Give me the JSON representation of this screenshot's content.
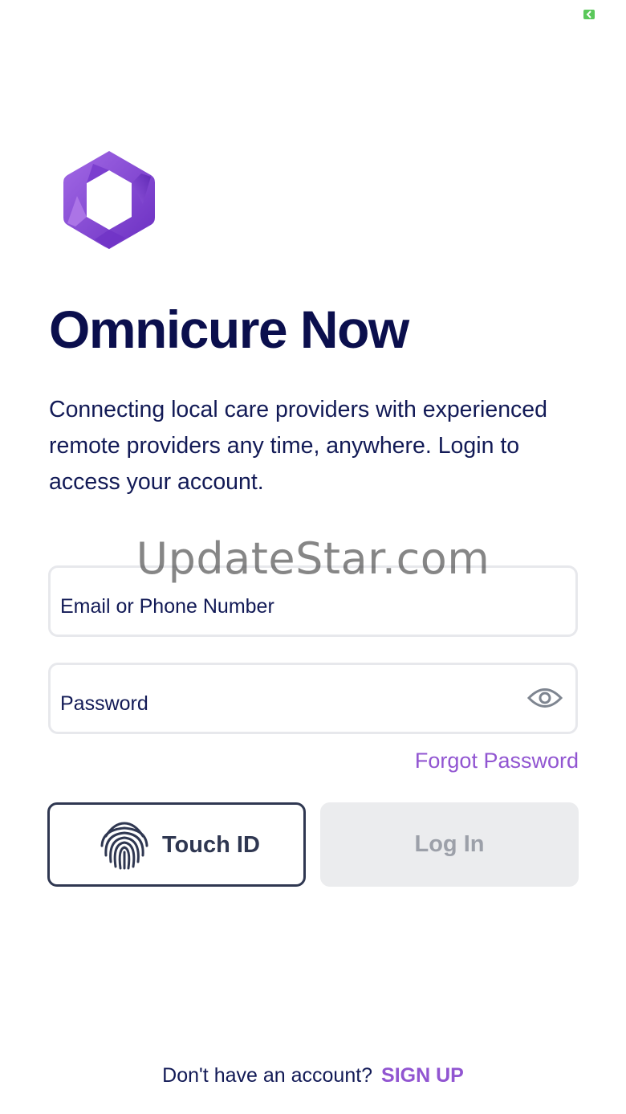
{
  "status_bar": {
    "battery_icon": "battery-charging-icon",
    "battery_color": "#5ac85a"
  },
  "logo": {
    "icon": "omnicure-hexagon-logo",
    "colors": [
      "#9d5ae0",
      "#6a2ec1",
      "#8447d6"
    ]
  },
  "app_title": "Omnicure Now",
  "tagline": "Connecting local care providers with experienced remote providers any time, anywhere. Login to access your account.",
  "watermark": "UpdateStar.com",
  "form": {
    "email_placeholder": "Email or Phone Number",
    "password_placeholder": "Password",
    "eye_icon": "eye-icon",
    "forgot_password": "Forgot Password"
  },
  "buttons": {
    "touch_id_label": "Touch ID",
    "touch_id_icon": "fingerprint-icon",
    "login_label": "Log In"
  },
  "footer": {
    "prompt": "Don't have an account?",
    "signup_label": "SIGN UP"
  },
  "colors": {
    "accent": "#9155d1",
    "title": "#0b0f4d",
    "text": "#121a56",
    "button_border": "#2f3751",
    "disabled_bg": "#ebecee",
    "disabled_text": "#9ca0a9",
    "field_border": "#e7e8ec"
  }
}
